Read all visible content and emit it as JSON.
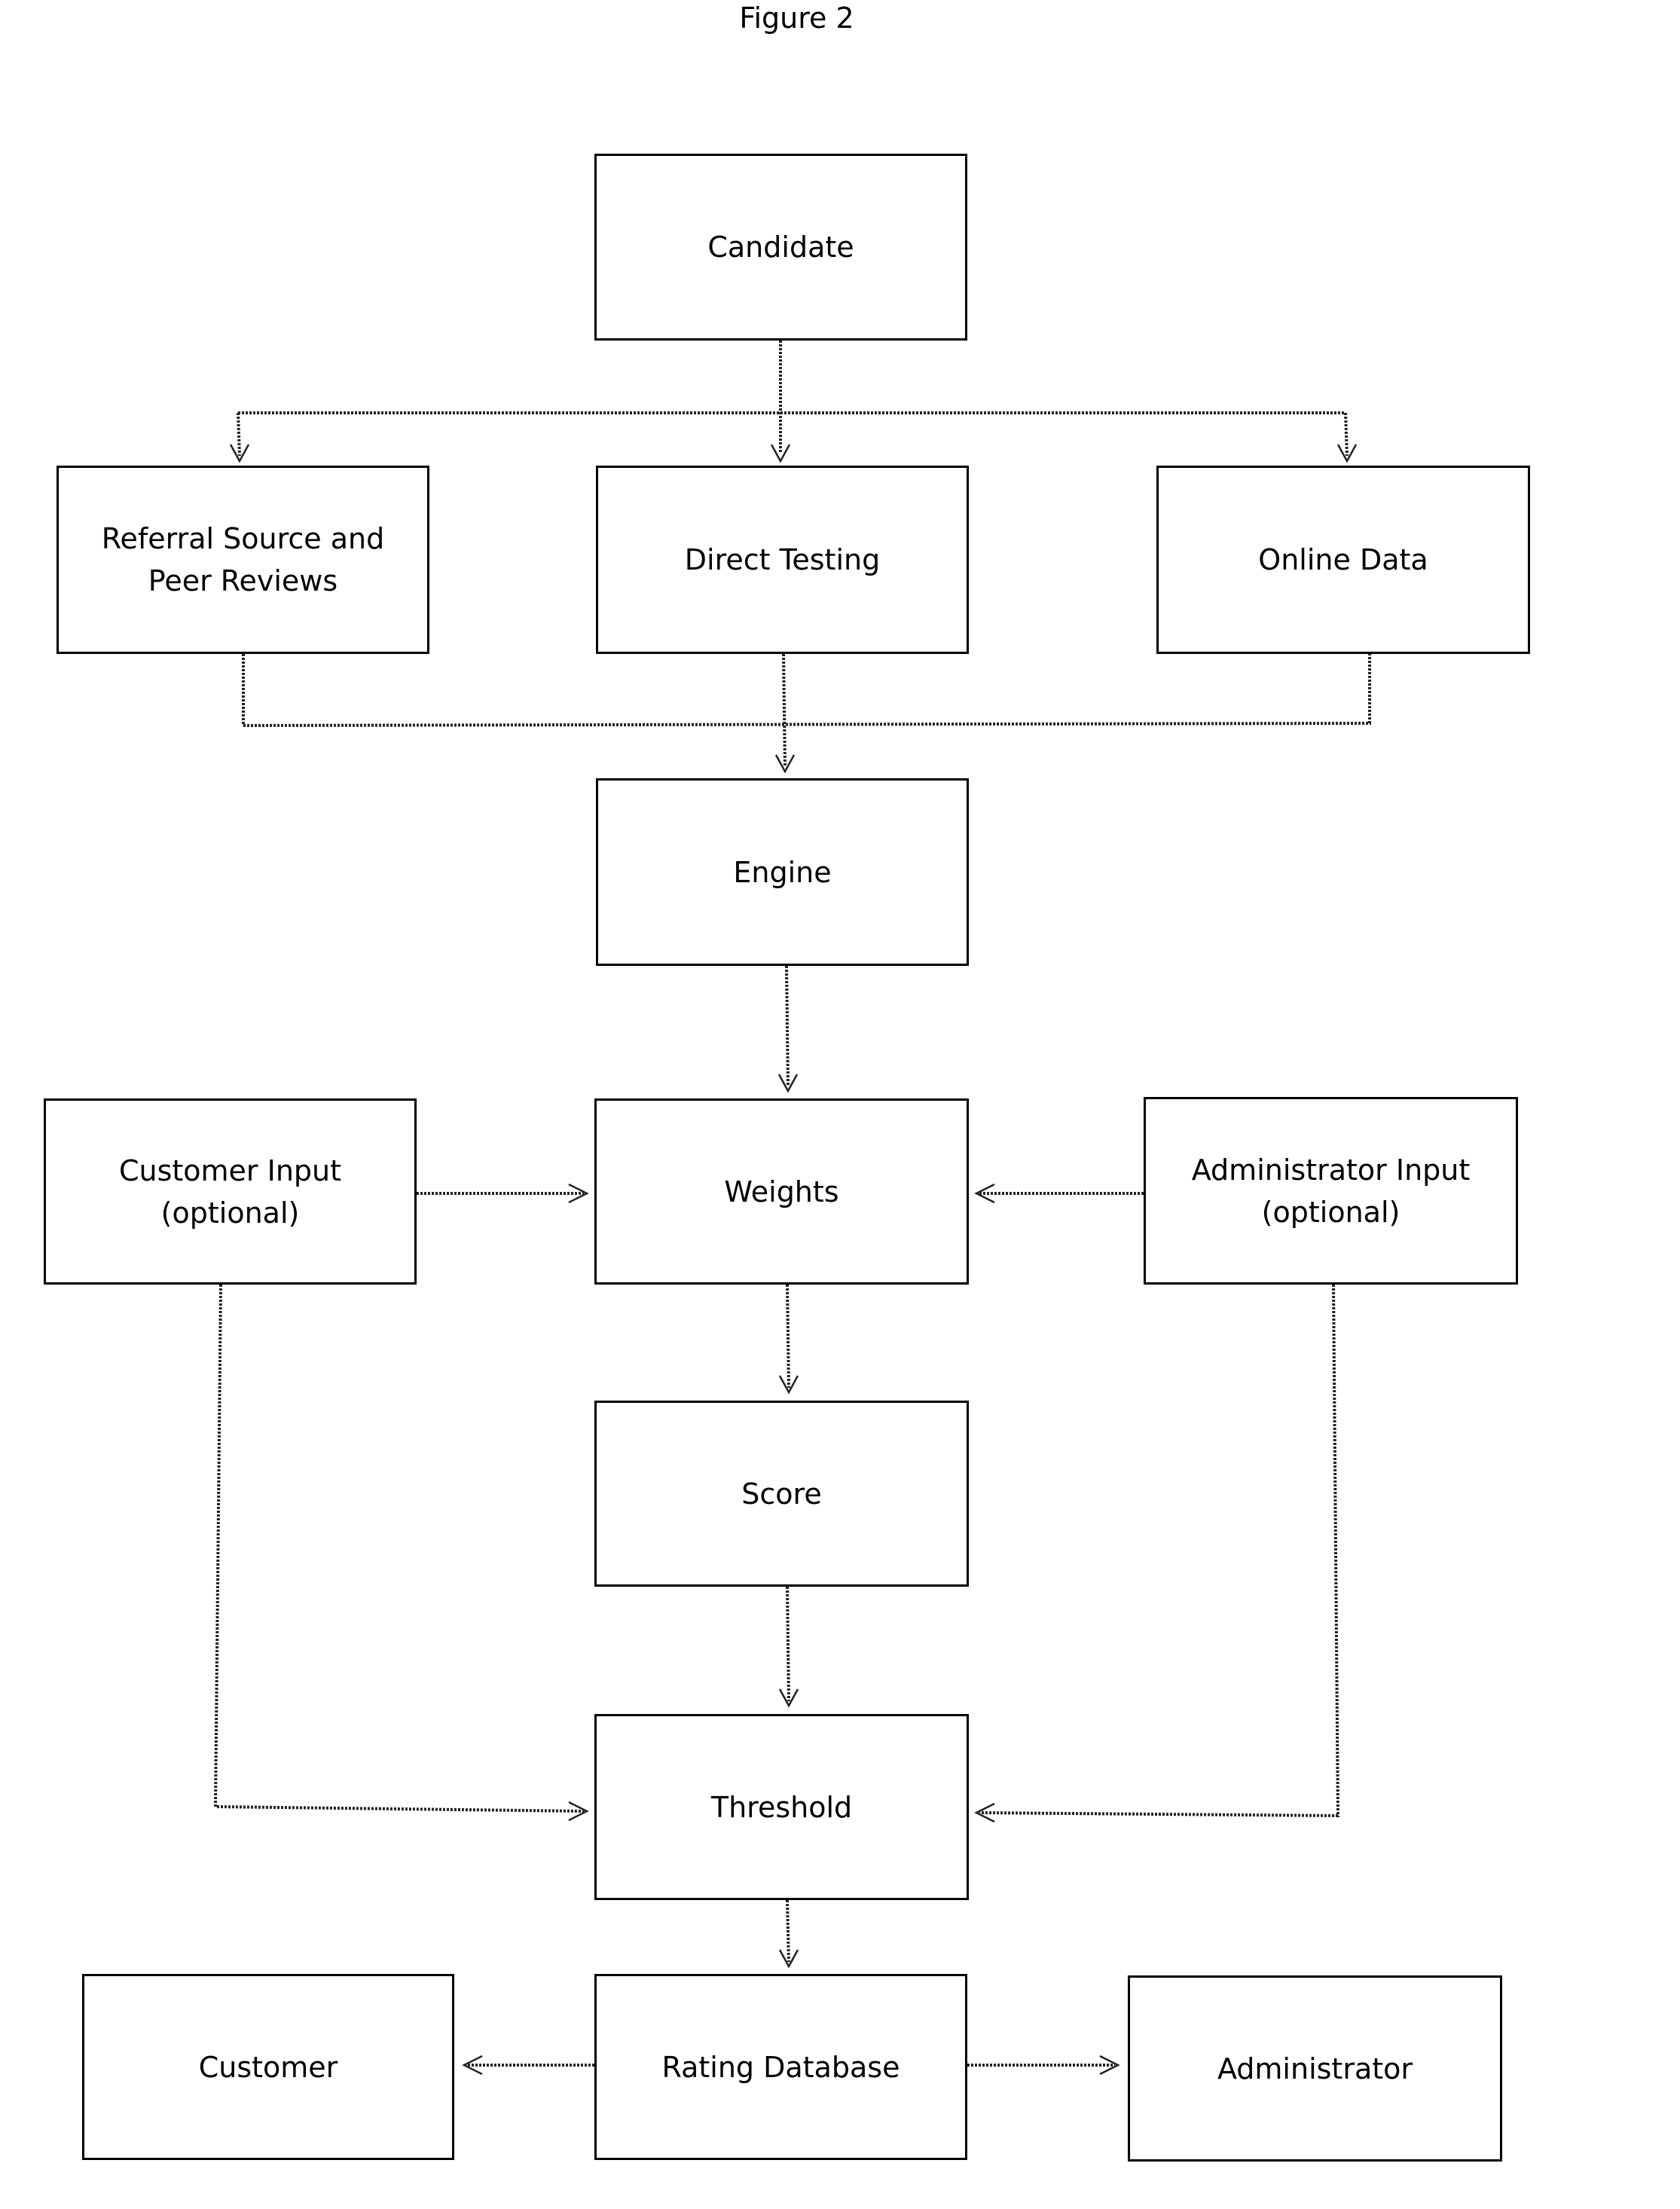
{
  "figure": {
    "title": "Figure 2"
  },
  "nodes": {
    "candidate": "Candidate",
    "referral": "Referral Source and\nPeer Reviews",
    "direct_testing": "Direct Testing",
    "online_data": "Online Data",
    "engine": "Engine",
    "customer_input": "Customer Input\n(optional)",
    "weights": "Weights",
    "administrator_input": "Administrator Input\n(optional)",
    "score": "Score",
    "threshold": "Threshold",
    "customer": "Customer",
    "rating_database": "Rating Database",
    "administrator": "Administrator"
  },
  "edges": [
    {
      "from": "Candidate",
      "to": "Referral Source and Peer Reviews"
    },
    {
      "from": "Candidate",
      "to": "Direct Testing"
    },
    {
      "from": "Candidate",
      "to": "Online Data"
    },
    {
      "from": "Referral Source and Peer Reviews",
      "to": "Engine"
    },
    {
      "from": "Direct Testing",
      "to": "Engine"
    },
    {
      "from": "Online Data",
      "to": "Engine"
    },
    {
      "from": "Engine",
      "to": "Weights"
    },
    {
      "from": "Customer Input (optional)",
      "to": "Weights"
    },
    {
      "from": "Administrator Input (optional)",
      "to": "Weights"
    },
    {
      "from": "Weights",
      "to": "Score"
    },
    {
      "from": "Score",
      "to": "Threshold"
    },
    {
      "from": "Customer Input (optional)",
      "to": "Threshold"
    },
    {
      "from": "Administrator Input (optional)",
      "to": "Threshold"
    },
    {
      "from": "Threshold",
      "to": "Rating Database"
    },
    {
      "from": "Rating Database",
      "to": "Customer"
    },
    {
      "from": "Rating Database",
      "to": "Administrator"
    }
  ],
  "style": {
    "line_color": "#222222",
    "box_border": "#000000"
  }
}
